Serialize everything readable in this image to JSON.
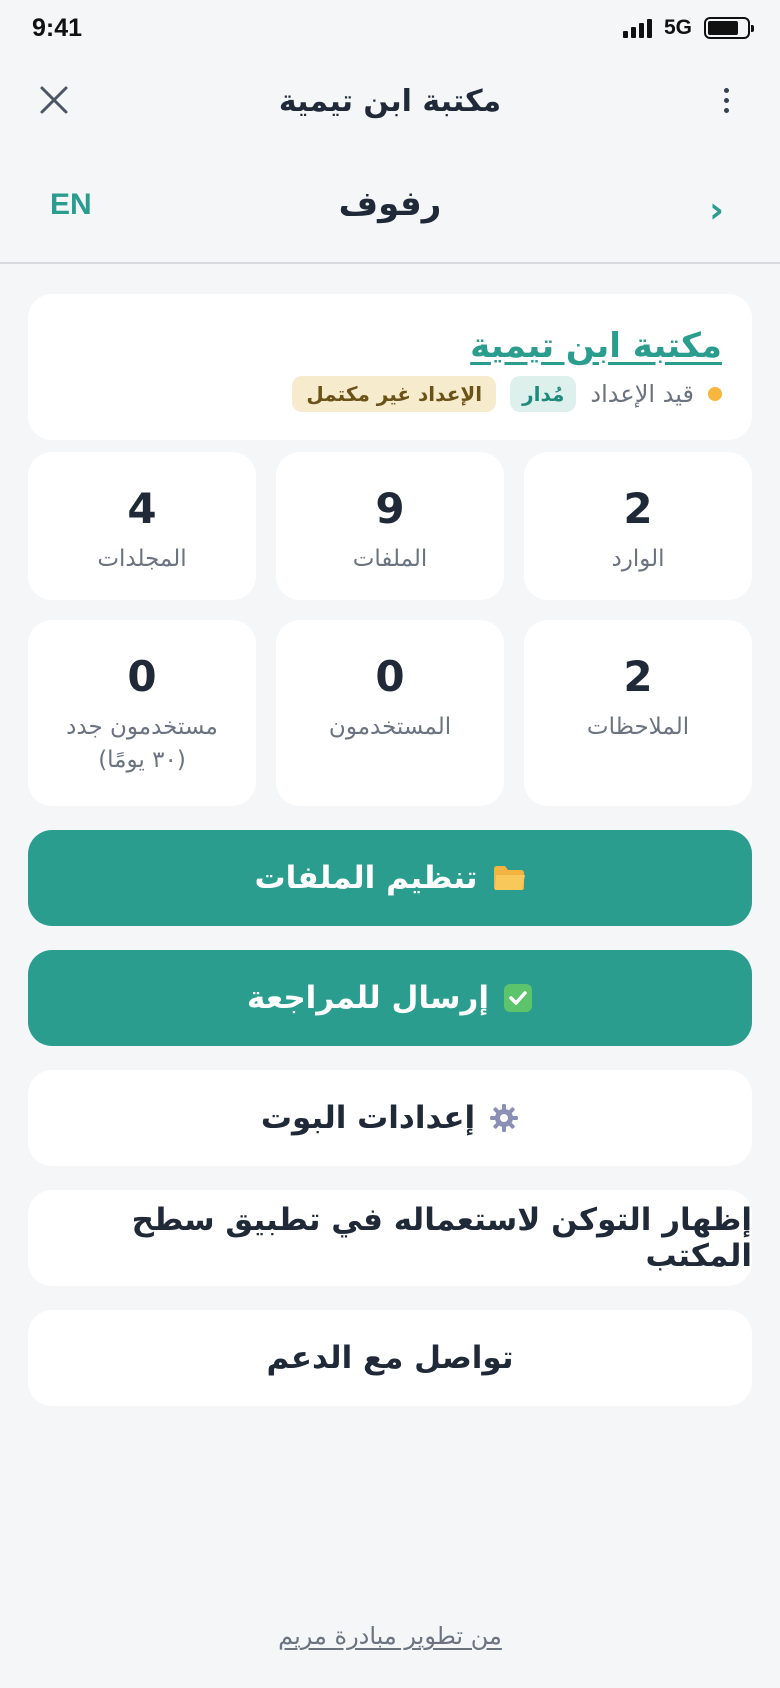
{
  "status_bar": {
    "time": "9:41",
    "network": "5G"
  },
  "header": {
    "title": "مكتبة ابن تيمية"
  },
  "sub_header": {
    "language": "EN",
    "title": "رفوف",
    "chevron": "›"
  },
  "library": {
    "name": "مكتبة ابن تيمية",
    "status": "قيد الإعداد",
    "badge_managed": "مُدار",
    "badge_setup": "الإعداد غير مكتمل",
    "colors": {
      "accent": "#2a9d8f",
      "status_dot": "#f6b73c"
    }
  },
  "stats": [
    {
      "value": "2",
      "label": "الوارد"
    },
    {
      "value": "9",
      "label": "الملفات"
    },
    {
      "value": "4",
      "label": "المجلدات"
    },
    {
      "value": "2",
      "label": "الملاحظات"
    },
    {
      "value": "0",
      "label": "المستخدمون"
    },
    {
      "value": "0",
      "label": "مستخدمون جدد (٣٠ يومًا)"
    }
  ],
  "actions": {
    "organize": {
      "icon": "folder-icon",
      "label": "تنظيم الملفات"
    },
    "submit_review": {
      "icon": "check-icon",
      "label": "إرسال للمراجعة"
    },
    "bot_settings": {
      "icon": "gear-icon",
      "label": "إعدادات البوت"
    },
    "show_token": {
      "label": "إظهار التوكن لاستعماله في تطبيق سطح المكتب"
    },
    "contact_support": {
      "label": "تواصل مع الدعم"
    }
  },
  "footer": {
    "credit": "من تطوير مبادرة مريم"
  }
}
